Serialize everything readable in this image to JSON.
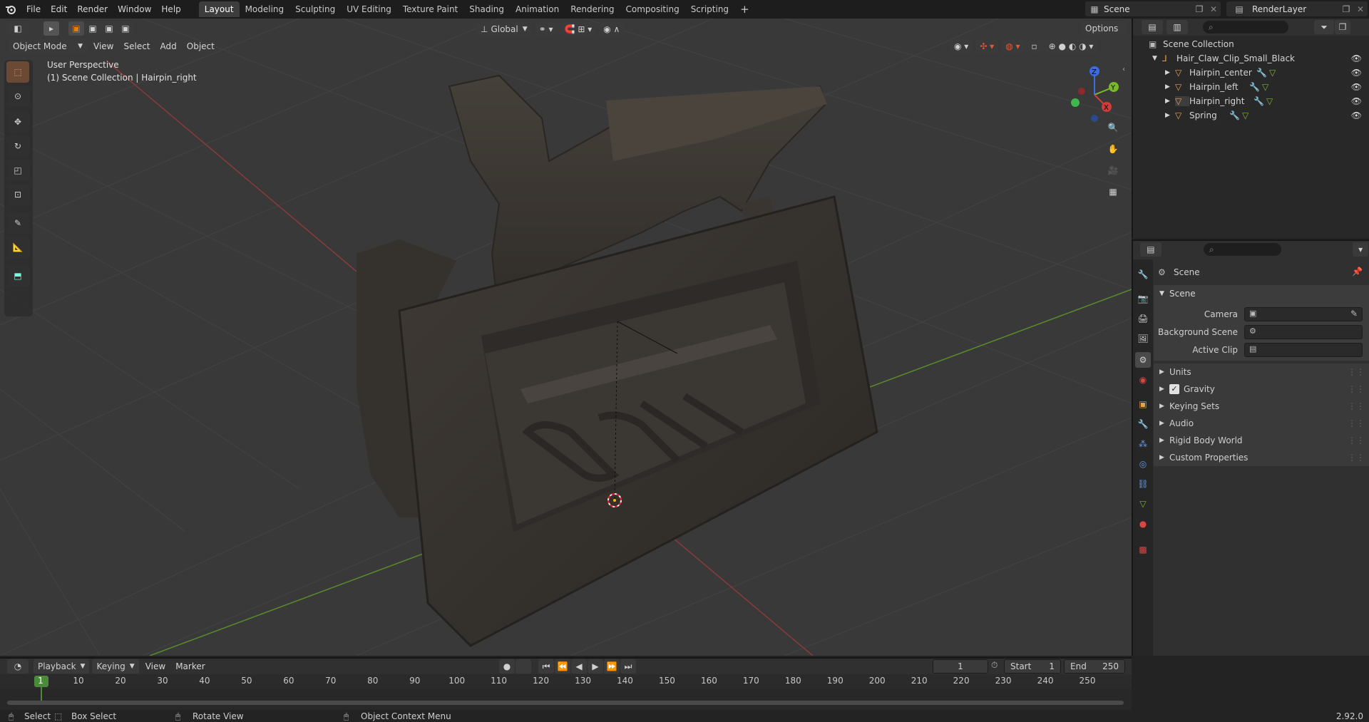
{
  "topbar": {
    "menus": [
      "File",
      "Edit",
      "Render",
      "Window",
      "Help"
    ],
    "workspaces": [
      "Layout",
      "Modeling",
      "Sculpting",
      "UV Editing",
      "Texture Paint",
      "Shading",
      "Animation",
      "Rendering",
      "Compositing",
      "Scripting"
    ],
    "active_workspace": "Layout",
    "add_tab": "+",
    "scene_name": "Scene",
    "view_layer": "RenderLayer"
  },
  "viewport_header": {
    "mode": "Object Mode",
    "menus": [
      "View",
      "Select",
      "Add",
      "Object"
    ],
    "orientation": "Global",
    "options": "Options"
  },
  "viewport": {
    "perspective": "User Perspective",
    "context": "(1) Scene Collection | Hairpin_right",
    "gizmo_axes": [
      "Z",
      "Y",
      "X"
    ]
  },
  "outliner": {
    "root": "Scene Collection",
    "collection": "Hair_Claw_Clip_Small_Black",
    "objects": [
      "Hairpin_center",
      "Hairpin_left",
      "Hairpin_right",
      "Spring"
    ]
  },
  "properties": {
    "breadcrumb": "Scene",
    "panel_title": "Scene",
    "fields": [
      {
        "label": "Camera"
      },
      {
        "label": "Background Scene"
      },
      {
        "label": "Active Clip"
      }
    ],
    "subpanels": [
      "Units",
      "Gravity",
      "Keying Sets",
      "Audio",
      "Rigid Body World",
      "Custom Properties"
    ]
  },
  "timeline": {
    "menus": [
      "Playback",
      "Keying",
      "View",
      "Marker"
    ],
    "current_frame": "1",
    "start_label": "Start",
    "start": "1",
    "end_label": "End",
    "end": "250",
    "ruler": [
      "1",
      "10",
      "20",
      "30",
      "40",
      "50",
      "60",
      "70",
      "80",
      "90",
      "100",
      "110",
      "120",
      "130",
      "140",
      "150",
      "160",
      "170",
      "180",
      "190",
      "200",
      "210",
      "220",
      "230",
      "240",
      "250"
    ]
  },
  "statusbar": {
    "select": "Select",
    "box_select": "Box Select",
    "rotate": "Rotate View",
    "context_menu": "Object Context Menu",
    "version": "2.92.0"
  },
  "colors": {
    "accent": "#e87d0d",
    "active_tab": "#3d3d3d",
    "bg": "#393939"
  }
}
